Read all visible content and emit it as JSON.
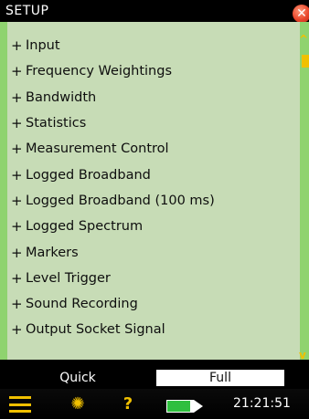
{
  "window": {
    "title": "SETUP"
  },
  "icons": {
    "close": "close-icon",
    "scroll_up": "chevron-up-icon",
    "scroll_down": "chevron-down-icon",
    "menu": "hamburger-menu-icon",
    "backlight": "lightbulb-icon",
    "help": "question-icon",
    "battery": "battery-icon"
  },
  "menu": {
    "items": [
      {
        "label": "Input"
      },
      {
        "label": "Frequency Weightings"
      },
      {
        "label": "Bandwidth"
      },
      {
        "label": "Statistics"
      },
      {
        "label": "Measurement Control"
      },
      {
        "label": "Logged Broadband"
      },
      {
        "label": "Logged Broadband (100 ms)"
      },
      {
        "label": "Logged Spectrum"
      },
      {
        "label": "Markers"
      },
      {
        "label": "Level Trigger"
      },
      {
        "label": "Sound Recording"
      },
      {
        "label": "Output Socket Signal"
      }
    ],
    "expand_symbol": "+"
  },
  "tabs": {
    "quick": "Quick",
    "full": "Full"
  },
  "status": {
    "time": "21:21:51"
  },
  "colors": {
    "panel": "#c7dcb6",
    "accent": "#8fd36f",
    "highlight": "#f0c000",
    "close": "#e8452a"
  }
}
